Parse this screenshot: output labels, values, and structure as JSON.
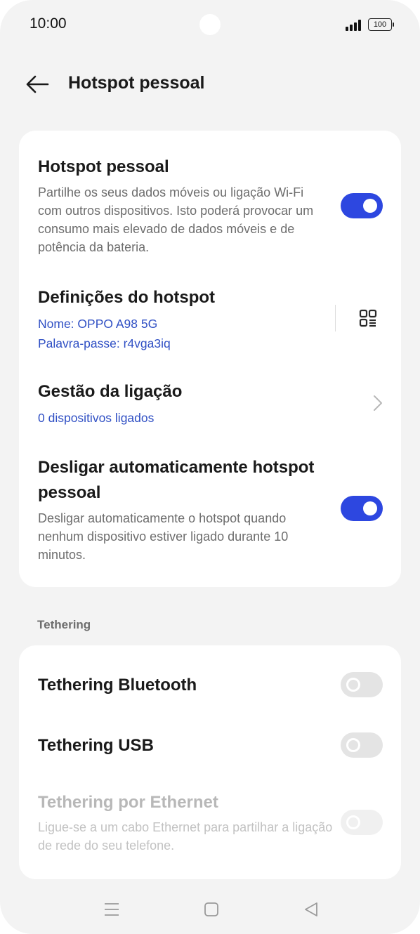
{
  "status_bar": {
    "time": "10:00",
    "battery": "100",
    "icons": [
      "signal-icon",
      "battery-icon"
    ]
  },
  "header": {
    "back_icon": "arrow-left-icon",
    "title": "Hotspot pessoal"
  },
  "settings": {
    "hotspot": {
      "title": "Hotspot pessoal",
      "description": "Partilhe os seus dados móveis ou ligação Wi-Fi com outros dispositivos. Isto poderá provocar um consumo mais elevado de dados móveis e de potência da bateria.",
      "enabled": true
    },
    "hotspot_settings": {
      "title": "Definições do hotspot",
      "name": "Nome: OPPO A98 5G",
      "password": "Palavra-passe: r4vga3iq",
      "icon": "qr-code-icon"
    },
    "connection_management": {
      "title": "Gestão da ligação",
      "subtitle": "0 dispositivos ligados",
      "icon": "chevron-right-icon"
    },
    "auto_off": {
      "title": "Desligar automaticamente hotspot pessoal",
      "description": "Desligar automaticamente o hotspot quando nenhum dispositivo estiver ligado durante 10 minutos.",
      "enabled": true
    }
  },
  "tethering": {
    "section_label": "Tethering",
    "bluetooth": {
      "title": "Tethering Bluetooth",
      "enabled": false
    },
    "usb": {
      "title": "Tethering USB",
      "enabled": false
    },
    "ethernet": {
      "title": "Tethering por Ethernet",
      "description": "Ligue-se a um cabo Ethernet para partilhar a ligação de rede do seu telefone.",
      "enabled": false,
      "disabled": true
    }
  },
  "nav_bar": {
    "icons": [
      "menu-icon",
      "home-icon",
      "back-triangle-icon"
    ]
  },
  "colors": {
    "accent": "#2d47e0",
    "link": "#2f4fc4",
    "background": "#f3f3f3",
    "card": "#ffffff"
  }
}
